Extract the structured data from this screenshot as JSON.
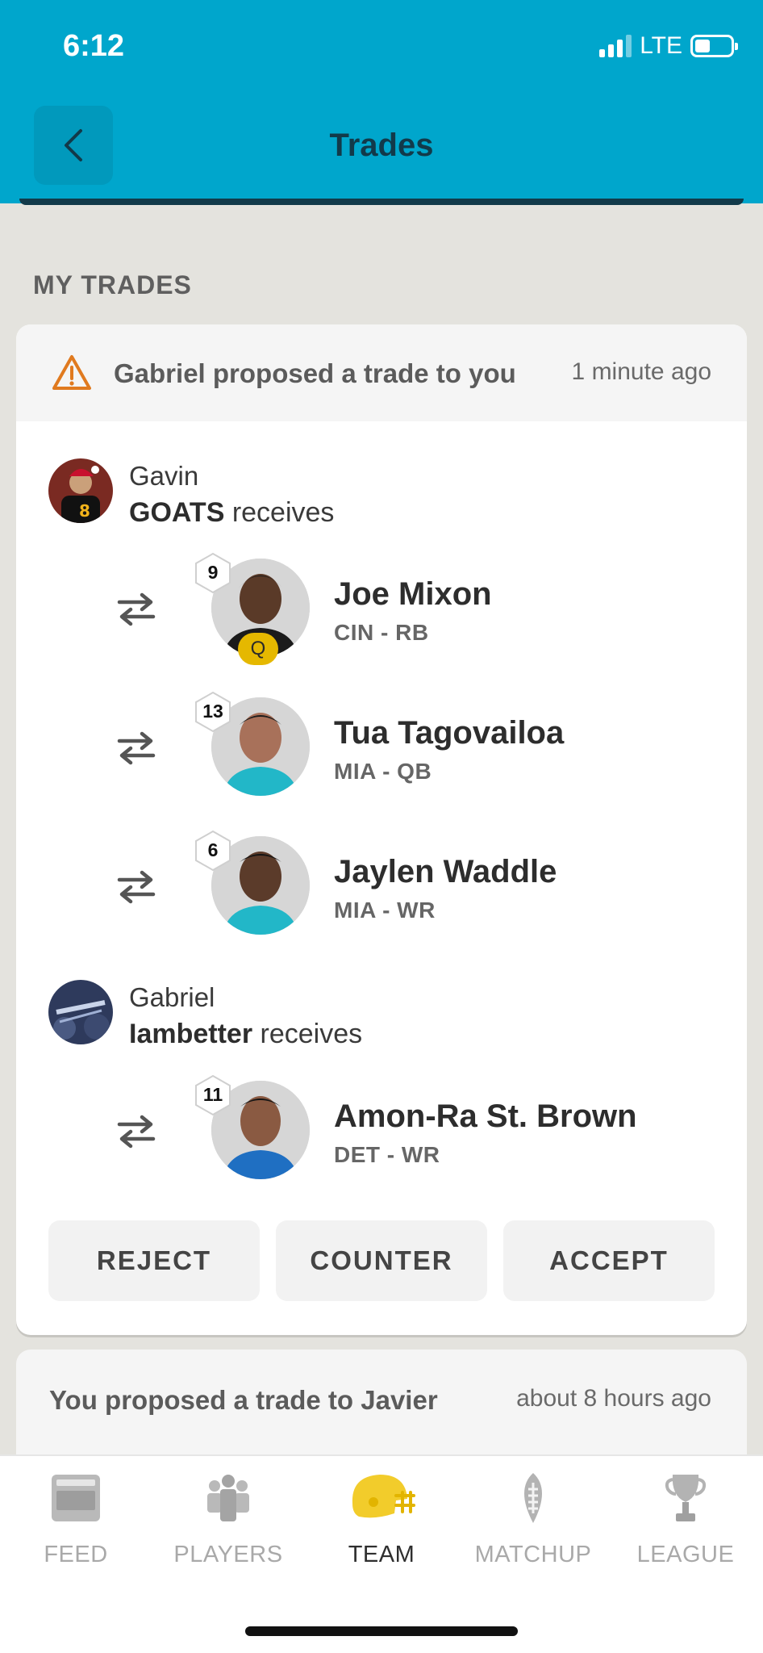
{
  "status_bar": {
    "time": "6:12",
    "network": "LTE"
  },
  "header": {
    "title": "Trades"
  },
  "section": {
    "label": "MY TRADES"
  },
  "trade1": {
    "message": "Gabriel proposed a trade to you",
    "time": "1 minute ago",
    "teams": [
      {
        "owner": "Gavin",
        "team_name": "GOATS",
        "receives_label": " receives",
        "players": [
          {
            "rank": "9",
            "name": "Joe Mixon",
            "info": "CIN - RB",
            "status": "Q"
          },
          {
            "rank": "13",
            "name": "Tua Tagovailoa",
            "info": "MIA - QB"
          },
          {
            "rank": "6",
            "name": "Jaylen Waddle",
            "info": "MIA - WR"
          }
        ]
      },
      {
        "owner": "Gabriel",
        "team_name": "Iambetter",
        "receives_label": " receives",
        "players": [
          {
            "rank": "11",
            "name": "Amon-Ra St. Brown",
            "info": "DET - WR"
          }
        ]
      }
    ],
    "actions": {
      "reject": "REJECT",
      "counter": "COUNTER",
      "accept": "ACCEPT"
    }
  },
  "trade2": {
    "message": "You proposed a trade to Javier",
    "time": "about 8 hours ago"
  },
  "nav": {
    "items": [
      {
        "label": "FEED",
        "icon": "feed-icon"
      },
      {
        "label": "PLAYERS",
        "icon": "players-icon"
      },
      {
        "label": "TEAM",
        "icon": "helmet-icon",
        "active": true
      },
      {
        "label": "MATCHUP",
        "icon": "football-icon"
      },
      {
        "label": "LEAGUE",
        "icon": "trophy-icon"
      }
    ]
  },
  "colors": {
    "header_bg": "#00a6cc",
    "warning": "#e07a1f",
    "active_nav": "#f2cc2b",
    "q_badge": "#e5b800"
  }
}
